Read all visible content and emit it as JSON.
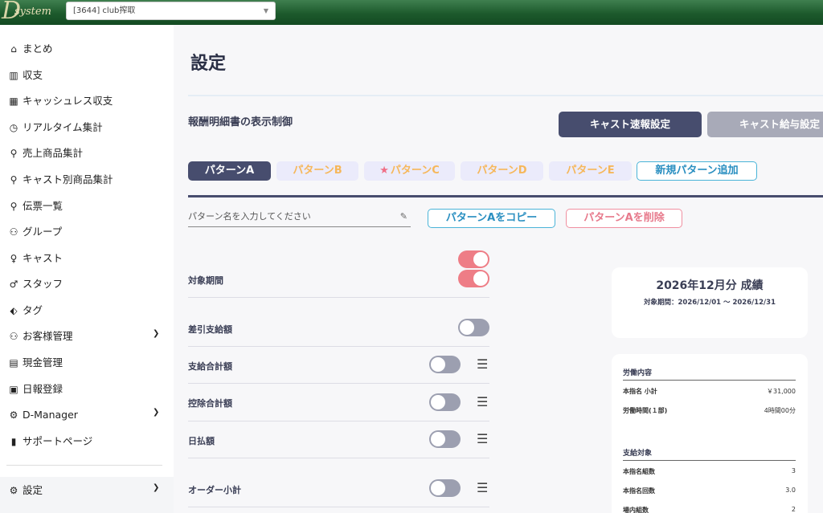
{
  "header": {
    "logo_text": "Dsystem",
    "store_select": "[3644] club搾取"
  },
  "sidebar": {
    "items": [
      {
        "label": "まとめ",
        "icon": "home-icon",
        "glyph": "⌂"
      },
      {
        "label": "収支",
        "icon": "bar-chart-icon",
        "glyph": "▥"
      },
      {
        "label": "キャッシュレス収支",
        "icon": "building-icon",
        "glyph": "▦"
      },
      {
        "label": "リアルタイム集計",
        "icon": "clock-icon",
        "glyph": "◷"
      },
      {
        "label": "売上商品集計",
        "icon": "bottle-icon",
        "glyph": "⚲"
      },
      {
        "label": "キャスト別商品集計",
        "icon": "bottle-icon",
        "glyph": "⚲"
      },
      {
        "label": "伝票一覧",
        "icon": "search-icon",
        "glyph": "⚲"
      },
      {
        "label": "グループ",
        "icon": "users-icon",
        "glyph": "⚇"
      },
      {
        "label": "キャスト",
        "icon": "person-icon",
        "glyph": "♀"
      },
      {
        "label": "スタッフ",
        "icon": "person-icon",
        "glyph": "♂"
      },
      {
        "label": "タグ",
        "icon": "tags-icon",
        "glyph": "⬖"
      },
      {
        "label": "お客様管理",
        "icon": "users-icon",
        "glyph": "⚇",
        "expand": true
      },
      {
        "label": "現金管理",
        "icon": "calculator-icon",
        "glyph": "▤"
      },
      {
        "label": "日報登録",
        "icon": "calendar-icon",
        "glyph": "▣"
      },
      {
        "label": "D-Manager",
        "icon": "gear-icon",
        "glyph": "⚙",
        "expand": true
      },
      {
        "label": "サポートページ",
        "icon": "file-icon",
        "glyph": "▮"
      }
    ],
    "settings": {
      "label": "設定",
      "icon": "gears-icon",
      "glyph": "⚙"
    }
  },
  "page": {
    "title": "設定",
    "section_label": "報酬明細書の表示制御",
    "buttons": {
      "cast_report": "キャスト速報設定",
      "cast_salary": "キャスト給与設定"
    },
    "tabs": [
      {
        "label": "パターンA",
        "active": true
      },
      {
        "label": "パターンB",
        "active": false
      },
      {
        "label": "パターンC",
        "active": false,
        "star": true
      },
      {
        "label": "パターンD",
        "active": false
      },
      {
        "label": "パターンE",
        "active": false
      }
    ],
    "add_pattern": "新規パターン追加",
    "name_placeholder": "パターン名を入力してください",
    "copy_button": "パターンAをコピー",
    "delete_button": "パターンAを削除"
  },
  "settings_rows": [
    {
      "label": "対象期間",
      "toggles": [
        true,
        true
      ]
    },
    {
      "label": "差引支給額",
      "toggles": [
        false
      ]
    },
    {
      "label": "支給合計額",
      "toggles": [
        false
      ],
      "draggable": true
    },
    {
      "label": "控除合計額",
      "toggles": [
        false
      ],
      "draggable": true
    },
    {
      "label": "日払額",
      "toggles": [
        false
      ],
      "draggable": true
    },
    {
      "label": "オーダー小計",
      "toggles": [
        false
      ],
      "draggable": true
    }
  ],
  "preview": {
    "title": "2026年12月分 成績",
    "period": "対象期間：2026/12/01 〜 2026/12/31",
    "labor_heading": "労働内容",
    "labor_rows": [
      {
        "label": "本指名 小計",
        "value": "￥31,000"
      },
      {
        "label": "労働時間(１部)",
        "value": "4時間00分"
      }
    ],
    "pay_heading": "支給対象",
    "pay_rows": [
      {
        "label": "本指名組数",
        "value": "3"
      },
      {
        "label": "本指名回数",
        "value": "3.0"
      },
      {
        "label": "場内組数",
        "value": "2"
      }
    ]
  },
  "colors": {
    "header_green": "#1d5a2c",
    "primary_dark": "#474d6e",
    "toggle_on": "#ee7d86",
    "toggle_off": "#9c9fb0",
    "tab_text": "#f6b75a",
    "accent_blue": "#4ab4d8",
    "danger_pink": "#f08fa0"
  }
}
